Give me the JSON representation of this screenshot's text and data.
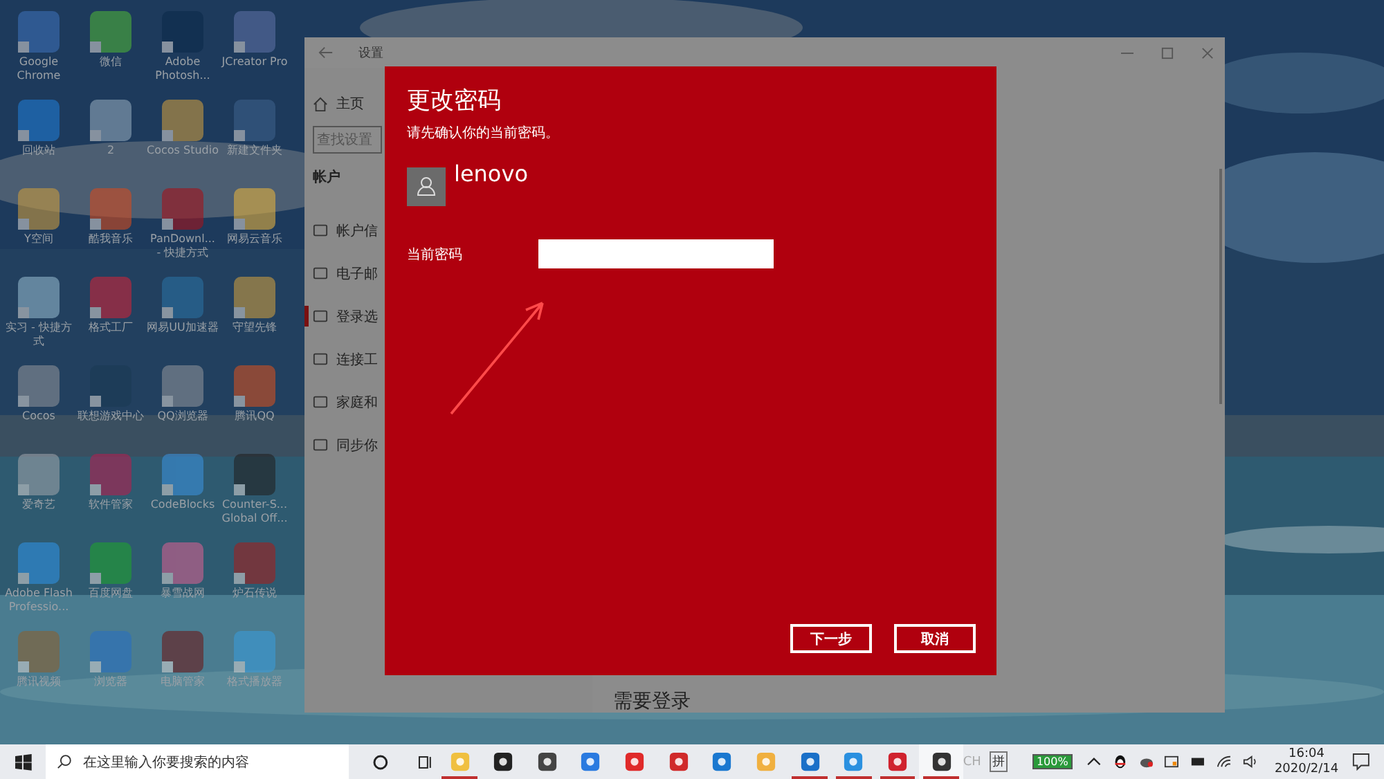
{
  "desktop": {
    "icons": [
      {
        "label": "Google Chrome"
      },
      {
        "label": "微信"
      },
      {
        "label": "Adobe Photosh..."
      },
      {
        "label": "JCreator Pro"
      },
      {
        "label": "回收站"
      },
      {
        "label": "2"
      },
      {
        "label": "Cocos Studio"
      },
      {
        "label": "新建文件夹"
      },
      {
        "label": "Y空间"
      },
      {
        "label": "酷我音乐"
      },
      {
        "label": "PanDownl... - 快捷方式"
      },
      {
        "label": "网易云音乐"
      },
      {
        "label": "实习 - 快捷方式"
      },
      {
        "label": "格式工厂"
      },
      {
        "label": "网易UU加速器"
      },
      {
        "label": "守望先锋"
      },
      {
        "label": "Cocos"
      },
      {
        "label": "联想游戏中心"
      },
      {
        "label": "QQ浏览器"
      },
      {
        "label": "腾讯QQ"
      },
      {
        "label": "爱奇艺"
      },
      {
        "label": "软件管家"
      },
      {
        "label": "CodeBlocks"
      },
      {
        "label": "Counter-S... Global Off..."
      },
      {
        "label": "Adobe Flash Professio..."
      },
      {
        "label": "百度网盘"
      },
      {
        "label": "暴雪战网"
      },
      {
        "label": "炉石传说"
      },
      {
        "label": "腾讯视频"
      },
      {
        "label": "浏览器"
      },
      {
        "label": "电脑管家"
      },
      {
        "label": "格式播放器"
      }
    ]
  },
  "settings_window": {
    "title": "设置",
    "home": "主页",
    "search_placeholder": "查找设置",
    "section": "帐户",
    "nav_items": [
      {
        "label": "帐户信",
        "selected": false
      },
      {
        "label": "电子邮",
        "selected": false
      },
      {
        "label": "登录选",
        "selected": true
      },
      {
        "label": "连接工",
        "selected": false
      },
      {
        "label": "家庭和",
        "selected": false
      },
      {
        "label": "同步你",
        "selected": false
      }
    ],
    "content_heading": "需要登录"
  },
  "dialog": {
    "title": "更改密码",
    "subtitle": "请先确认你的当前密码。",
    "user_name": "lenovo",
    "field_label": "当前密码",
    "buttons": [
      {
        "label": "下一步"
      },
      {
        "label": "取消"
      }
    ]
  },
  "taskbar": {
    "search_placeholder": "在这里输入你要搜索的内容",
    "apps": [
      {
        "running": true,
        "selected": false
      },
      {
        "running": false,
        "selected": false
      },
      {
        "running": false,
        "selected": false
      },
      {
        "running": false,
        "selected": false
      },
      {
        "running": false,
        "selected": false
      },
      {
        "running": false,
        "selected": false
      },
      {
        "running": false,
        "selected": false
      },
      {
        "running": false,
        "selected": false
      },
      {
        "running": true,
        "selected": false
      },
      {
        "running": true,
        "selected": false
      },
      {
        "running": true,
        "selected": false
      },
      {
        "running": true,
        "selected": true
      }
    ],
    "language": "CH",
    "ime": "拼",
    "battery": "100%",
    "time": "16:04",
    "date": "2020/2/14"
  }
}
